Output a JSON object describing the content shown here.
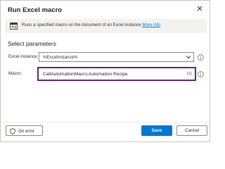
{
  "dialog": {
    "title": "Run Excel macro"
  },
  "banner": {
    "description": "Runs a specified macro on the document of an Excel instance",
    "link_label": "More info"
  },
  "section": {
    "title": "Select parameters"
  },
  "fields": {
    "excel_instance": {
      "label": "Excel instance:",
      "value": "%ExcelInstance%"
    },
    "macro": {
      "label": "Macro:",
      "value": "CallAutomationMacro;Automation Recipe",
      "variable_button": "{x}"
    }
  },
  "footer": {
    "on_error_label": "On error",
    "save_label": "Save",
    "cancel_label": "Cancel"
  },
  "colors": {
    "accent": "#0078d4",
    "highlight_border": "#68217a",
    "banner_bg": "#f3f2f1"
  },
  "icons": [
    "close-icon",
    "excel-macro-icon",
    "chevron-down-icon",
    "help-icon",
    "shield-icon"
  ]
}
